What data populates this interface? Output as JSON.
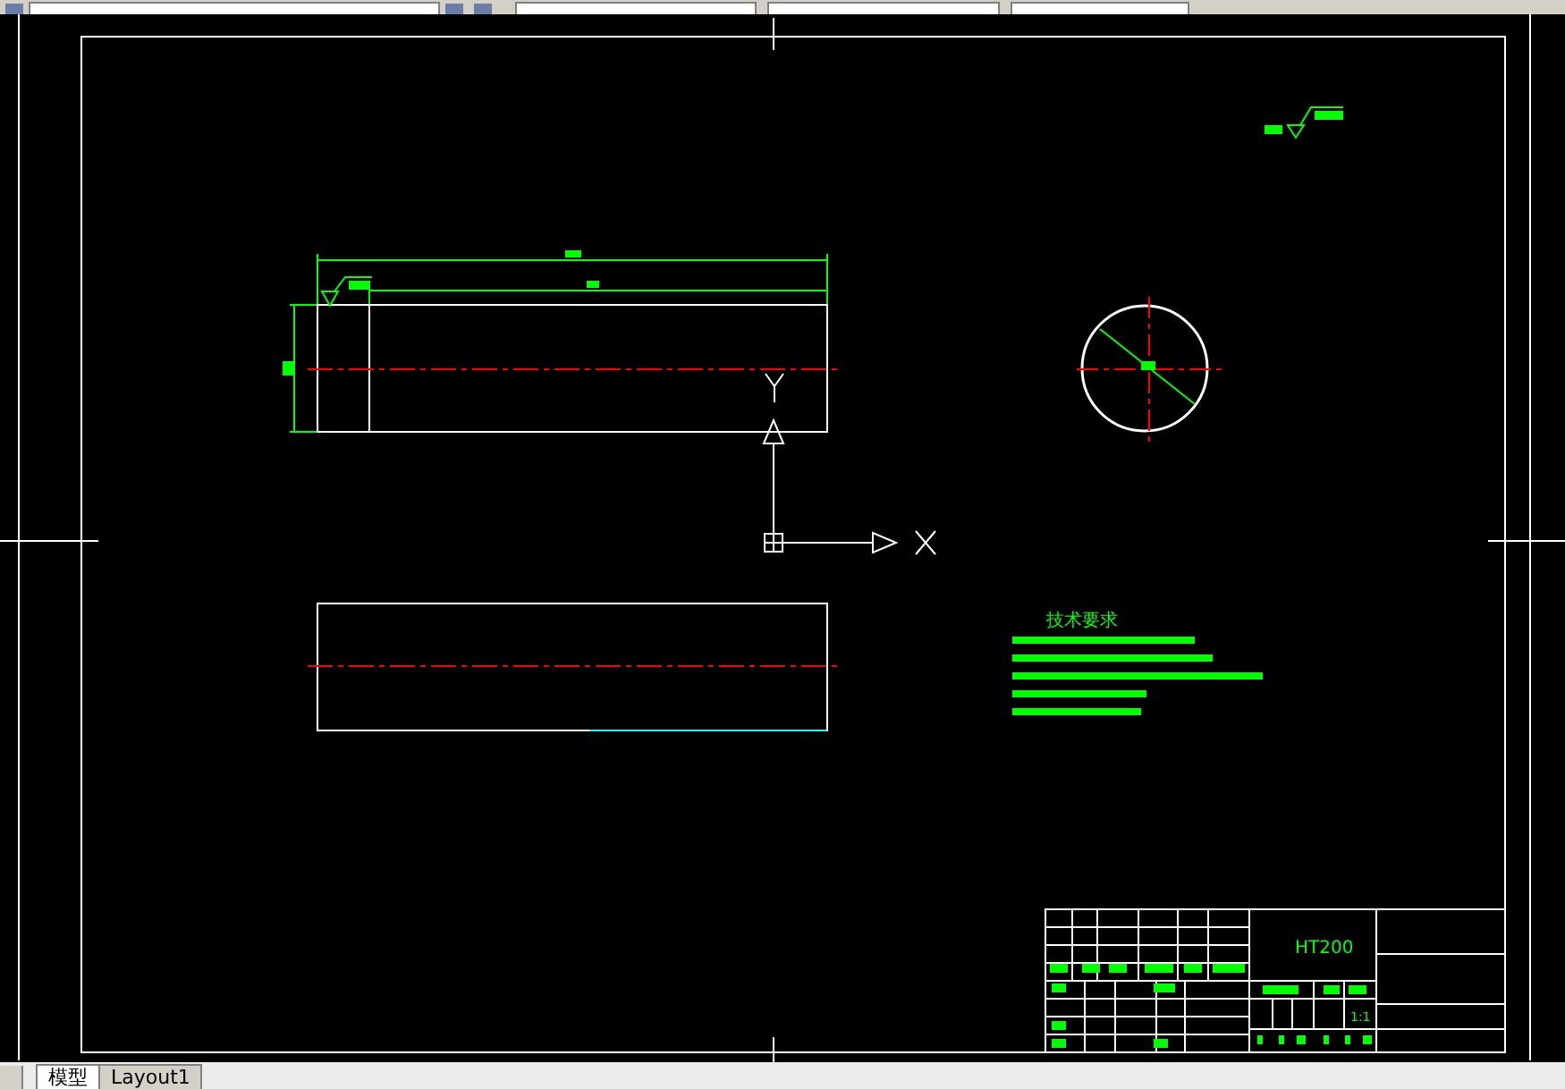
{
  "drawing": {
    "notes_title": "技术要求",
    "material": "HT200",
    "scale": "1:1"
  },
  "layout_tabs": [
    {
      "label": "模型",
      "selected": true
    },
    {
      "label": "Layout1",
      "selected": false
    }
  ]
}
